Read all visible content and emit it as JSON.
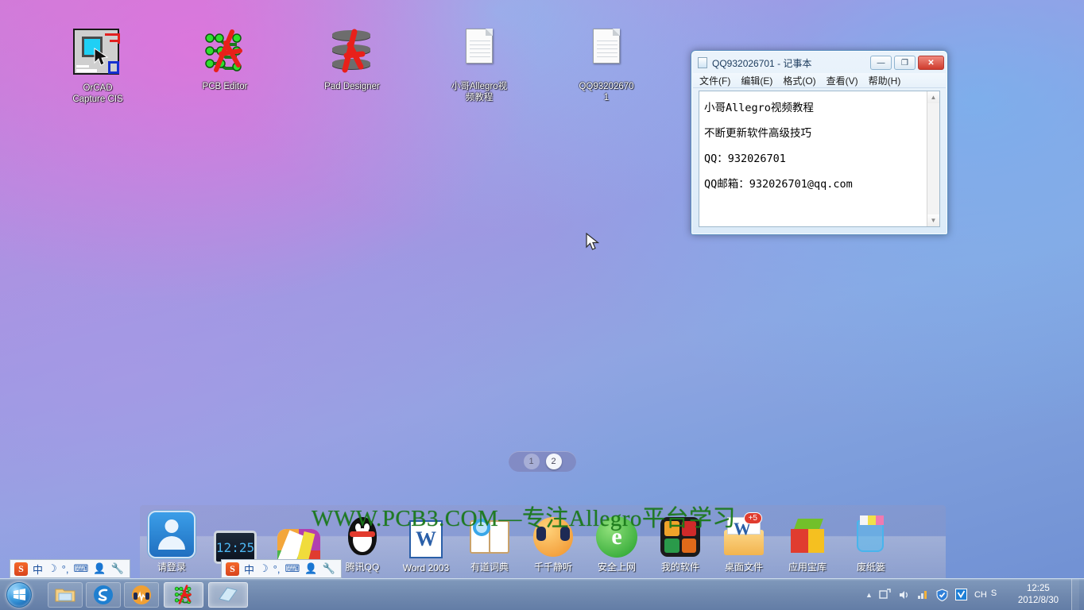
{
  "desktop": {
    "icons": [
      {
        "name": "orcad-capture-cis",
        "label": "OrCAD\nCapture CIS",
        "label_line1": "OrCAD",
        "label_line2": "Capture CIS"
      },
      {
        "name": "pcb-editor",
        "label": "PCB Editor",
        "label_line1": "PCB Editor",
        "label_line2": ""
      },
      {
        "name": "pad-designer",
        "label": "Pad Designer",
        "label_line1": "Pad Designer",
        "label_line2": ""
      },
      {
        "name": "allegro-video-tutorial",
        "label": "小哥Allegro视频教程",
        "label_line1": "小哥Allegro视",
        "label_line2": "频教程"
      },
      {
        "name": "qq-text-file",
        "label": "QQ932026701",
        "label_line1": "QQ93202670",
        "label_line2": "1"
      }
    ],
    "page_indicator": {
      "pages": [
        "1",
        "2"
      ],
      "active": "2"
    },
    "watermark": "WWW.PCB3.COM—专注Allegro平台学习"
  },
  "notepad": {
    "title": "QQ932026701 - 记事本",
    "window_buttons": {
      "minimize": "—",
      "maximize": "❐",
      "close": "✕"
    },
    "menu": [
      "文件(F)",
      "编辑(E)",
      "格式(O)",
      "查看(V)",
      "帮助(H)"
    ],
    "content_lines": [
      "小哥Allegro视频教程",
      "不断更新软件高级技巧",
      "QQ：932026701",
      "QQ邮箱：932026701@qq.com"
    ],
    "scroll_up": "▲",
    "scroll_down": "▼"
  },
  "dock": {
    "items": [
      {
        "name": "login-account",
        "label": "请登录",
        "icon": "user-avatar-icon"
      },
      {
        "name": "clock-widget",
        "label": "",
        "icon": "monitor-clock-icon",
        "value": "12:25"
      },
      {
        "name": "pinwheel-app",
        "label": "",
        "icon": "pinwheel-icon"
      },
      {
        "name": "tencent-qq",
        "label": "腾讯QQ",
        "icon": "qq-penguin-icon"
      },
      {
        "name": "word-2003",
        "label": "Word 2003",
        "icon": "word-icon"
      },
      {
        "name": "youdao-dict",
        "label": "有道词典",
        "icon": "dictionary-icon"
      },
      {
        "name": "qianqian-player",
        "label": "千千静听",
        "icon": "music-headphone-icon"
      },
      {
        "name": "safe-browsing",
        "label": "安全上网",
        "icon": "browser-e-icon"
      },
      {
        "name": "my-software",
        "label": "我的软件",
        "icon": "software-folder-icon"
      },
      {
        "name": "desktop-files",
        "label": "桌面文件",
        "icon": "desktop-folder-icon",
        "badge": "+5"
      },
      {
        "name": "app-treasury",
        "label": "应用宝库",
        "icon": "cube-icon"
      },
      {
        "name": "recycle-bin",
        "label": "废纸篓",
        "icon": "trash-basket-icon"
      }
    ]
  },
  "ime_bars": [
    {
      "name": "ime-toolbar-left",
      "items": [
        "S",
        "中",
        "☽",
        "°,",
        "⌨",
        "👤",
        "🔧"
      ]
    },
    {
      "name": "ime-toolbar-dock",
      "items": [
        "S",
        "中",
        "☽",
        "°,",
        "⌨",
        "👤",
        "🔧"
      ]
    }
  ],
  "taskbar": {
    "start_label": "开始",
    "buttons": [
      {
        "name": "taskbar-explorer",
        "icon": "folder-icon",
        "active": false
      },
      {
        "name": "taskbar-sogou",
        "icon": "sogou-browser-icon",
        "active": false
      },
      {
        "name": "taskbar-music",
        "icon": "music-headphone-icon",
        "active": false
      },
      {
        "name": "taskbar-pcb-editor",
        "icon": "pcb-editor-icon",
        "active": true
      },
      {
        "name": "taskbar-notepad",
        "icon": "notepad-icon",
        "active": true
      }
    ],
    "tray": {
      "language": "CH",
      "ime_badge": "S",
      "overflow": "▲",
      "icons": [
        "action-center-icon",
        "volume-icon",
        "network-icon",
        "security-shield-icon",
        "antivirus-icon"
      ],
      "time": "12:25",
      "date": "2012/8/30"
    }
  },
  "colors": {
    "accent": "#2a6da8",
    "taskbar": "#6f88ae",
    "watermark_green": "#1a7a1a",
    "close_red": "#cf3b2c"
  }
}
